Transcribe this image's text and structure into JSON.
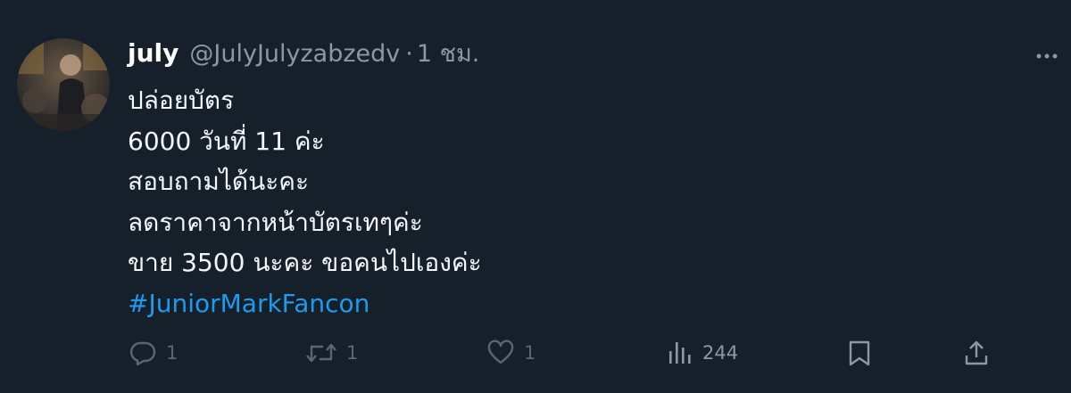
{
  "author": {
    "display_name": "july",
    "handle": "@JulyJulyzabzedv",
    "separator": "·",
    "time": "1 ชม."
  },
  "body_lines": [
    "ปล่อยบัตร",
    "6000 วันที่ 11 ค่ะ",
    "สอบถามได้นะคะ",
    "ลดราคาจากหน้าบัตรเทๆค่ะ",
    "ขาย 3500 นะคะ ขอคนไปเองค่ะ"
  ],
  "hashtag": "#JuniorMarkFancon",
  "actions": {
    "reply_count": "1",
    "retweet_count": "1",
    "like_count": "1",
    "view_count": "244"
  },
  "icons": {
    "avatar": "profile-photo",
    "more": "more-dots-icon",
    "reply": "reply-icon",
    "retweet": "retweet-icon",
    "like": "heart-icon",
    "views": "views-chart-icon",
    "bookmark": "bookmark-icon",
    "share": "share-icon"
  },
  "colors": {
    "background": "#15202b",
    "text": "#f5f8fa",
    "muted": "#8b98a5",
    "link": "#1d9bf0"
  }
}
